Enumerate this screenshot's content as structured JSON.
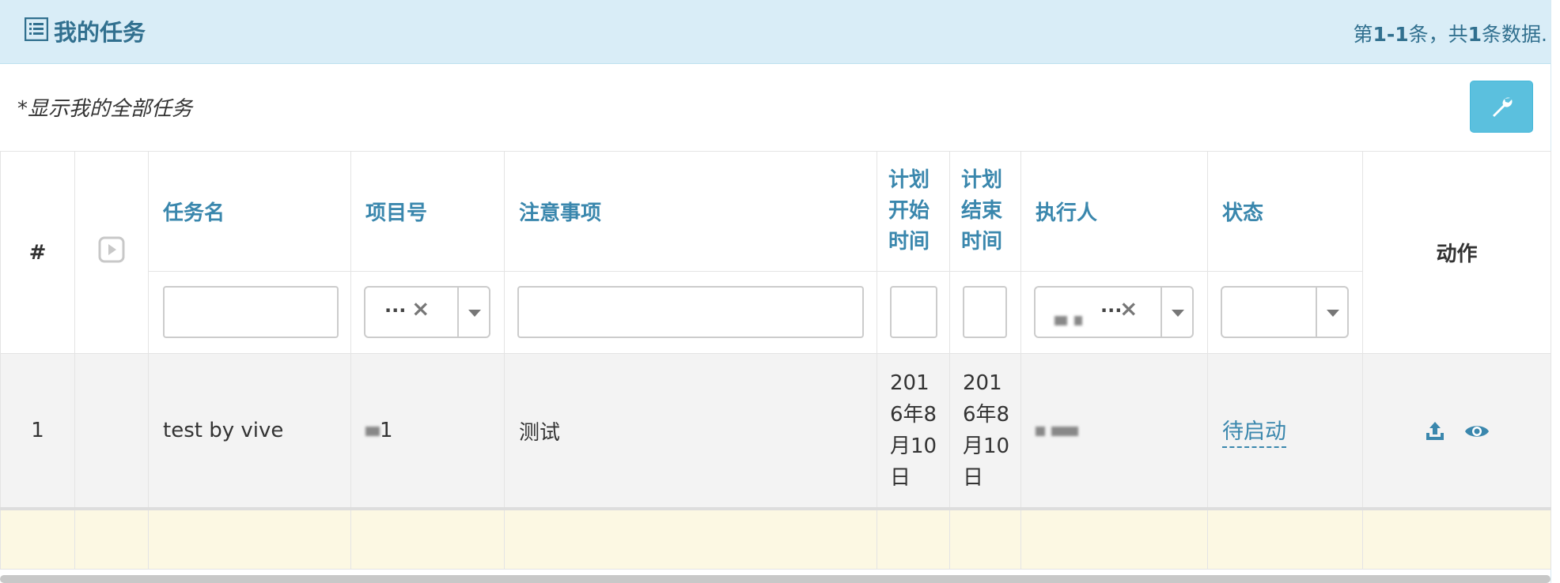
{
  "header": {
    "title": "我的任务",
    "summary_prefix": "第",
    "summary_range": "1-1",
    "summary_mid": "条，共",
    "summary_total": "1",
    "summary_suffix": "条数据."
  },
  "toolbar": {
    "note": "*显示我的全部任务",
    "tool_icon": "wrench-icon"
  },
  "columns": {
    "index": "#",
    "task_name": "任务名",
    "project_no": "项目号",
    "notes": "注意事项",
    "plan_start": "计划开始时间",
    "plan_end": "计划结束时间",
    "executor": "执行人",
    "status": "状态",
    "actions": "动作"
  },
  "filters": {
    "project_no_value": "···",
    "executor_value": "···"
  },
  "rows": [
    {
      "index": "1",
      "task_name": "test by vive",
      "project_no": "1",
      "notes": "测试",
      "plan_start": "2016年8月10日",
      "plan_end": "2016年8月10日",
      "status": "待启动"
    }
  ],
  "colors": {
    "heading_bg": "#d9edf7",
    "accent": "#3a87ad",
    "button": "#5bc0de",
    "footer_row": "#fcf8e3"
  }
}
